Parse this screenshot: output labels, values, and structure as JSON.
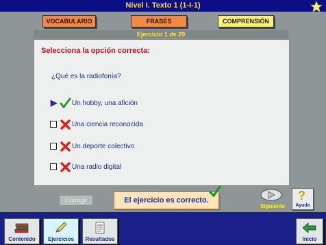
{
  "window_title": "Nivel I. Texto 1 (1-I-1)",
  "tabs": [
    {
      "label": "VOCABULARIO"
    },
    {
      "label": "FRASES"
    },
    {
      "label": "COMPRENSIÓN"
    }
  ],
  "exercise_counter": "Ejercicio 1 de 29",
  "instruction": "Selecciona la opción correcta:",
  "question": "¿Qué es la radiofonía?",
  "options": [
    {
      "text": "Un hobby, una afición",
      "status": "correct"
    },
    {
      "text": "Una ciencia reconocida",
      "status": "incorrect"
    },
    {
      "text": "Un deporte colectivo",
      "status": "incorrect"
    },
    {
      "text": "Una radio digital",
      "status": "incorrect"
    }
  ],
  "corregir_label": "Corregir",
  "feedback": "El ejercicio es correcto.",
  "siguiente_label": "Siguiente",
  "ayuda_label": "Ayuda",
  "bottom_nav": [
    {
      "label": "Contenido"
    },
    {
      "label": "Ejercicios"
    },
    {
      "label": "Resultados"
    },
    {
      "label": "Inicio"
    }
  ],
  "colors": {
    "title_bg": "#0a0f86",
    "title_text": "#ffd94a",
    "instruction": "#c20f1f",
    "option_text": "#1a2c8c"
  }
}
